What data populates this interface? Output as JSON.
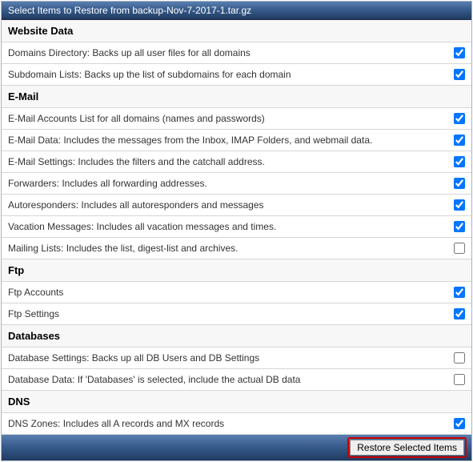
{
  "title": "Select Items to Restore from backup-Nov-7-2017-1.tar.gz",
  "sections": [
    {
      "header": "Website Data",
      "items": [
        {
          "label": "Domains Directory: Backs up all user files for all domains",
          "checked": true
        },
        {
          "label": "Subdomain Lists: Backs up the list of subdomains for each domain",
          "checked": true
        }
      ]
    },
    {
      "header": "E-Mail",
      "items": [
        {
          "label": "E-Mail Accounts List for all domains (names and passwords)",
          "checked": true
        },
        {
          "label": "E-Mail Data: Includes the messages from the Inbox, IMAP Folders, and webmail data.",
          "checked": true
        },
        {
          "label": "E-Mail Settings: Includes the filters and the catchall address.",
          "checked": true
        },
        {
          "label": "Forwarders: Includes all forwarding addresses.",
          "checked": true
        },
        {
          "label": "Autoresponders: Includes all autoresponders and messages",
          "checked": true
        },
        {
          "label": "Vacation Messages: Includes all vacation messages and times.",
          "checked": true
        },
        {
          "label": "Mailing Lists: Includes the list, digest-list and archives.",
          "checked": false
        }
      ]
    },
    {
      "header": "Ftp",
      "items": [
        {
          "label": "Ftp Accounts",
          "checked": true
        },
        {
          "label": "Ftp Settings",
          "checked": true
        }
      ]
    },
    {
      "header": "Databases",
      "items": [
        {
          "label": "Database Settings: Backs up all DB Users and DB Settings",
          "checked": false
        },
        {
          "label": "Database Data: If 'Databases' is selected, include the actual DB data",
          "checked": false
        }
      ]
    },
    {
      "header": "DNS",
      "items": [
        {
          "label": "DNS Zones: Includes all A records and MX records",
          "checked": true
        }
      ]
    }
  ],
  "footer": {
    "restore_label": "Restore Selected Items"
  }
}
